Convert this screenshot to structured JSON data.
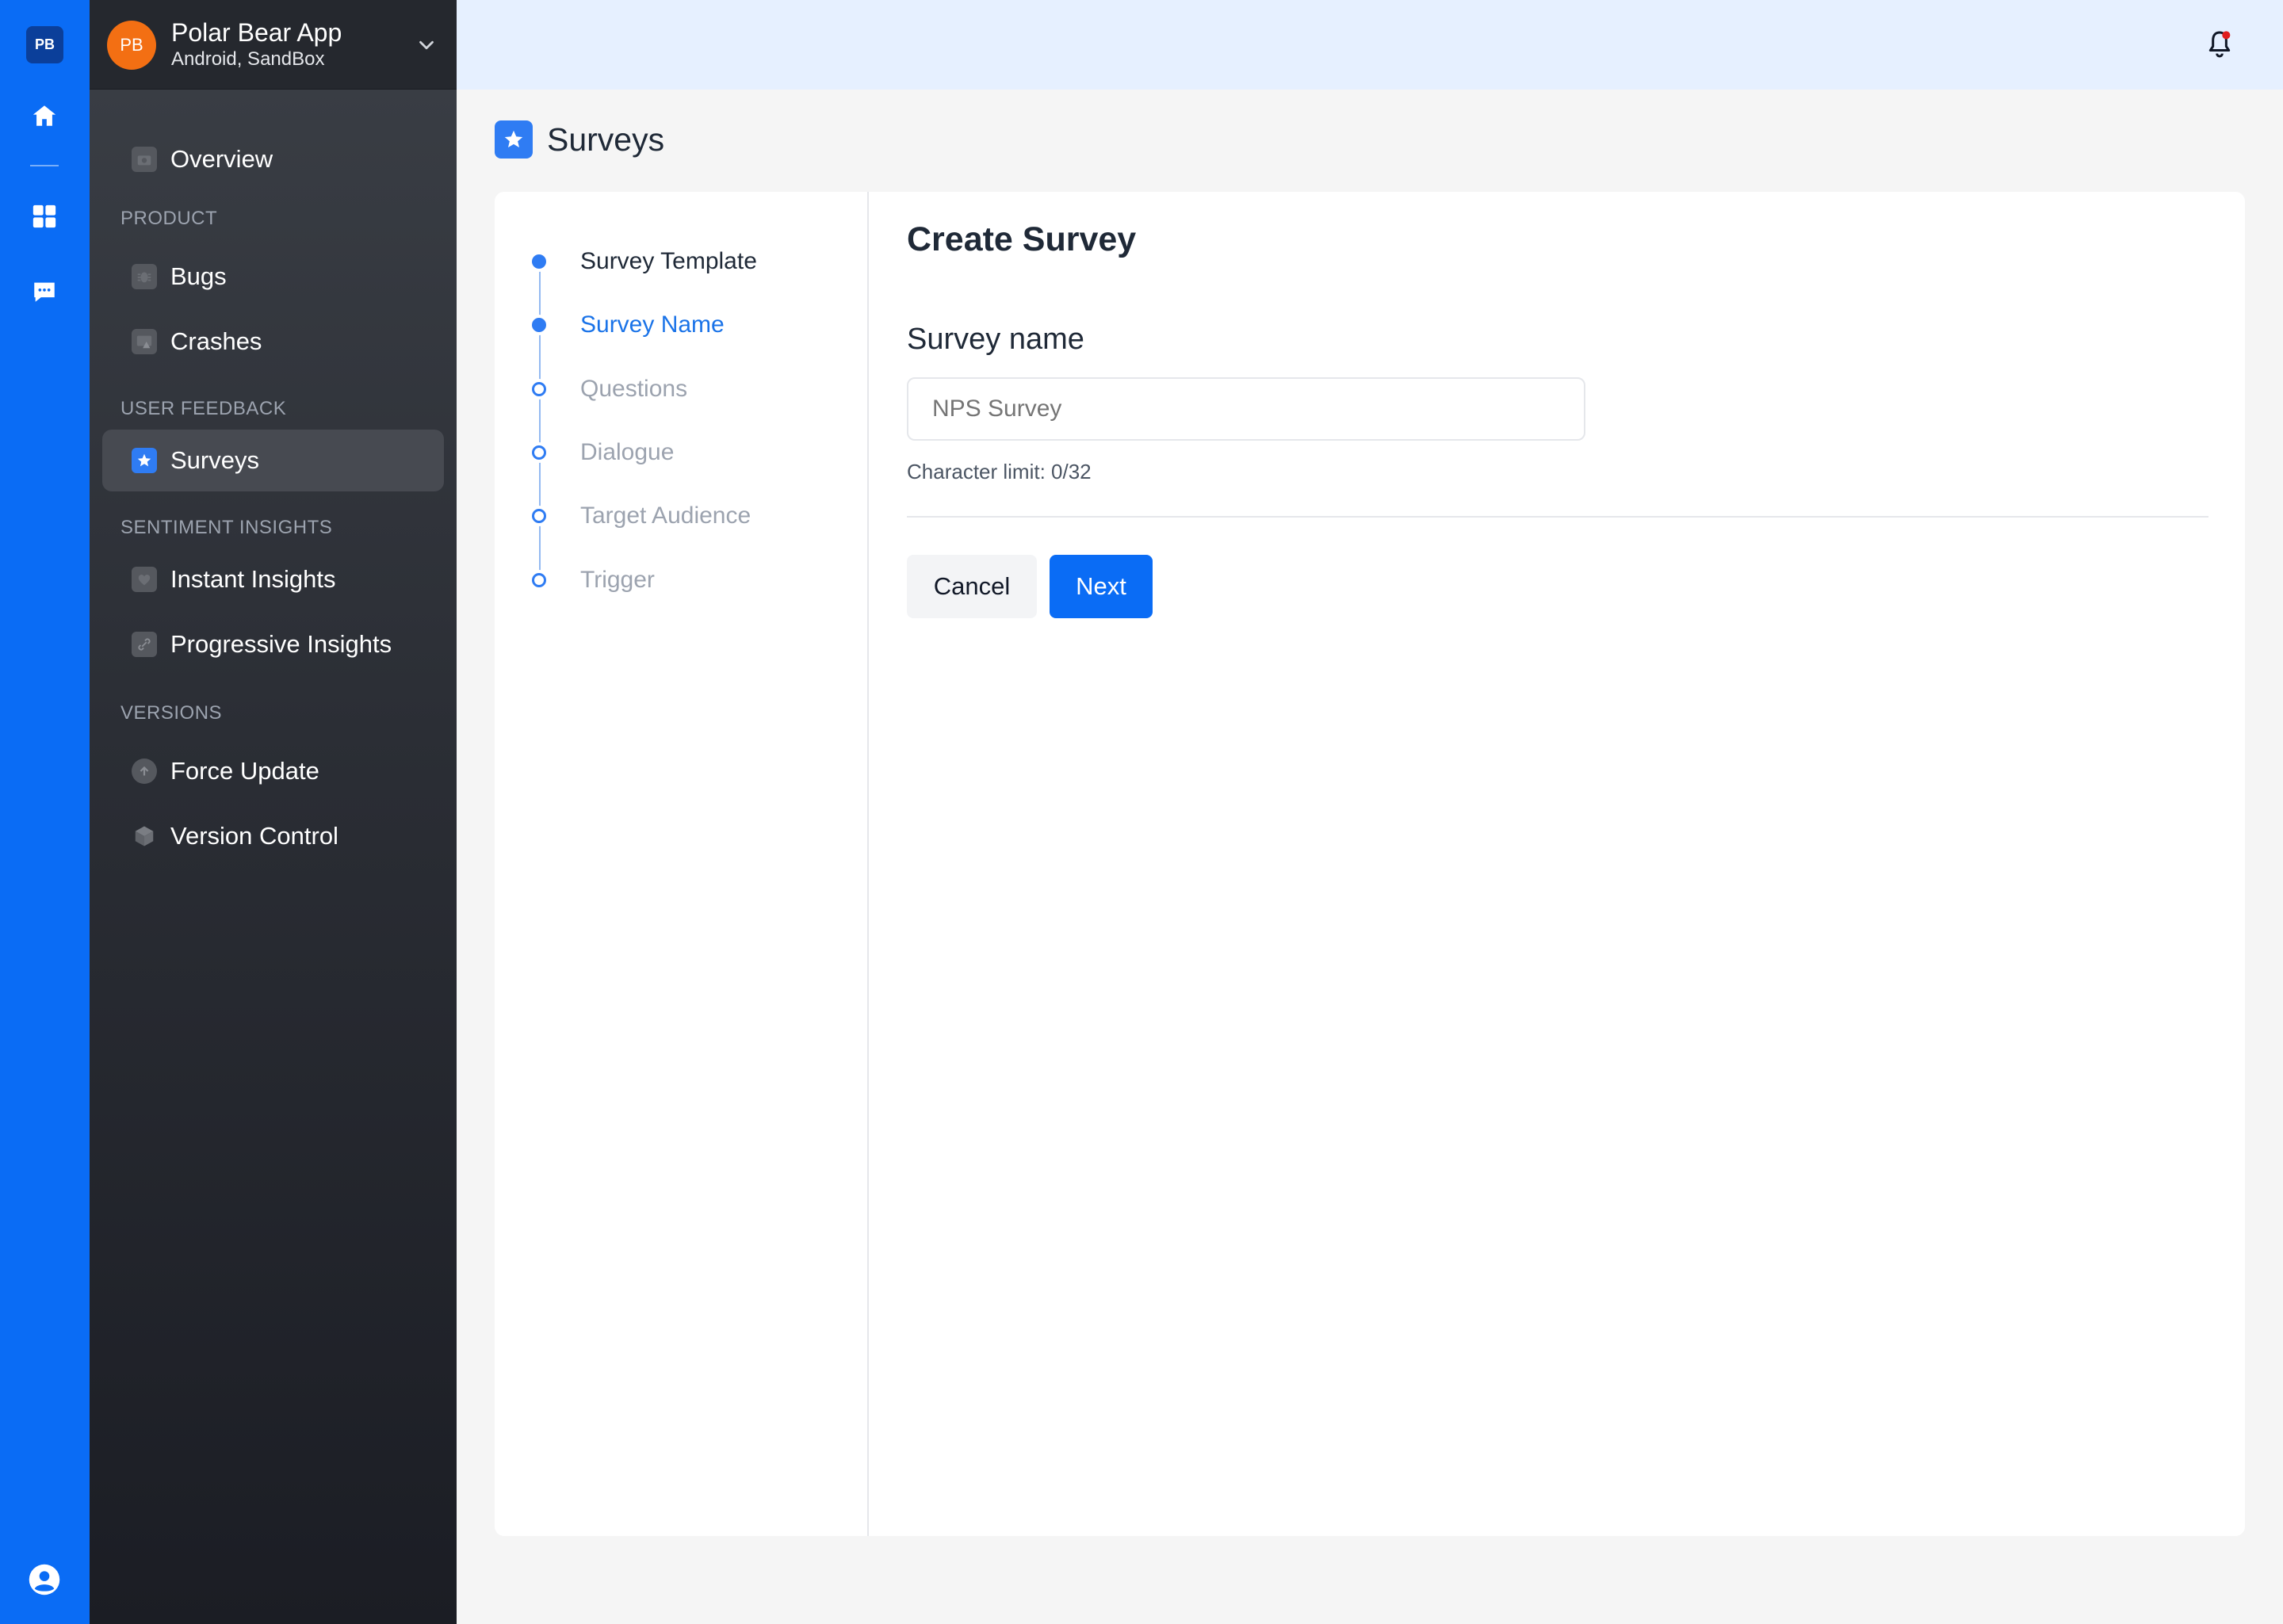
{
  "rail": {
    "badge": "PB"
  },
  "sidebar": {
    "app": {
      "avatar": "PB",
      "name": "Polar Bear App",
      "subtitle": "Android, SandBox"
    },
    "overview": "Overview",
    "sections": {
      "product": "PRODUCT",
      "user_feedback": "USER FEEDBACK",
      "sentiment": "SENTIMENT INSIGHTS",
      "versions": "VERSIONS"
    },
    "items": {
      "bugs": "Bugs",
      "crashes": "Crashes",
      "surveys": "Surveys",
      "instant_insights": "Instant Insights",
      "progressive_insights": "Progressive Insights",
      "force_update": "Force Update",
      "version_control": "Version Control"
    },
    "active": "Surveys"
  },
  "page": {
    "title": "Surveys"
  },
  "stepper": {
    "steps": [
      {
        "label": "Survey Template",
        "state": "done"
      },
      {
        "label": "Survey Name",
        "state": "current"
      },
      {
        "label": "Questions",
        "state": "todo"
      },
      {
        "label": "Dialogue",
        "state": "todo"
      },
      {
        "label": "Target Audience",
        "state": "todo"
      },
      {
        "label": "Trigger",
        "state": "todo"
      }
    ]
  },
  "form": {
    "title": "Create Survey",
    "field_label": "Survey name",
    "input_placeholder": "NPS Survey",
    "input_value": "",
    "hint": "Character limit: 0/32",
    "cancel": "Cancel",
    "next": "Next"
  },
  "colors": {
    "rail": "#0a6cf5",
    "accent": "#2f7cf3",
    "topbar": "#e6f0ff",
    "avatar": "#f36f13"
  }
}
